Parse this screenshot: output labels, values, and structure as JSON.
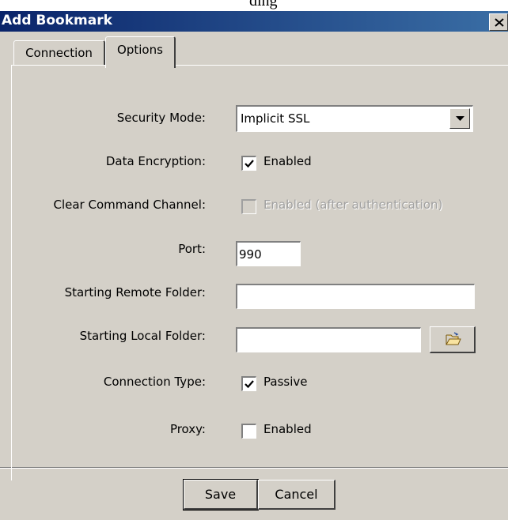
{
  "top_caption": "ding",
  "window": {
    "title": "Add Bookmark",
    "close_label": "X"
  },
  "tabs": [
    {
      "label": "Connection",
      "active": false
    },
    {
      "label": "Options",
      "active": true
    }
  ],
  "form": {
    "security_mode": {
      "label": "Security Mode:",
      "value": "Implicit SSL"
    },
    "data_encryption": {
      "label": "Data Encryption:",
      "checkbox_label": "Enabled",
      "checked": true
    },
    "clear_command_channel": {
      "label": "Clear Command Channel:",
      "checkbox_label": "Enabled (after authentication)",
      "checked": false,
      "disabled": true
    },
    "port": {
      "label": "Port:",
      "value": "990"
    },
    "starting_remote_folder": {
      "label": "Starting Remote Folder:",
      "value": ""
    },
    "starting_local_folder": {
      "label": "Starting Local Folder:",
      "value": ""
    },
    "connection_type": {
      "label": "Connection Type:",
      "checkbox_label": "Passive",
      "checked": true
    },
    "proxy": {
      "label": "Proxy:",
      "checkbox_label": "Enabled",
      "checked": false
    }
  },
  "buttons": {
    "save_label": "Save",
    "cancel_label": "Cancel"
  },
  "icons": {
    "close": "close-icon",
    "dropdown": "chevron-down-icon",
    "browse": "folder-open-icon"
  }
}
